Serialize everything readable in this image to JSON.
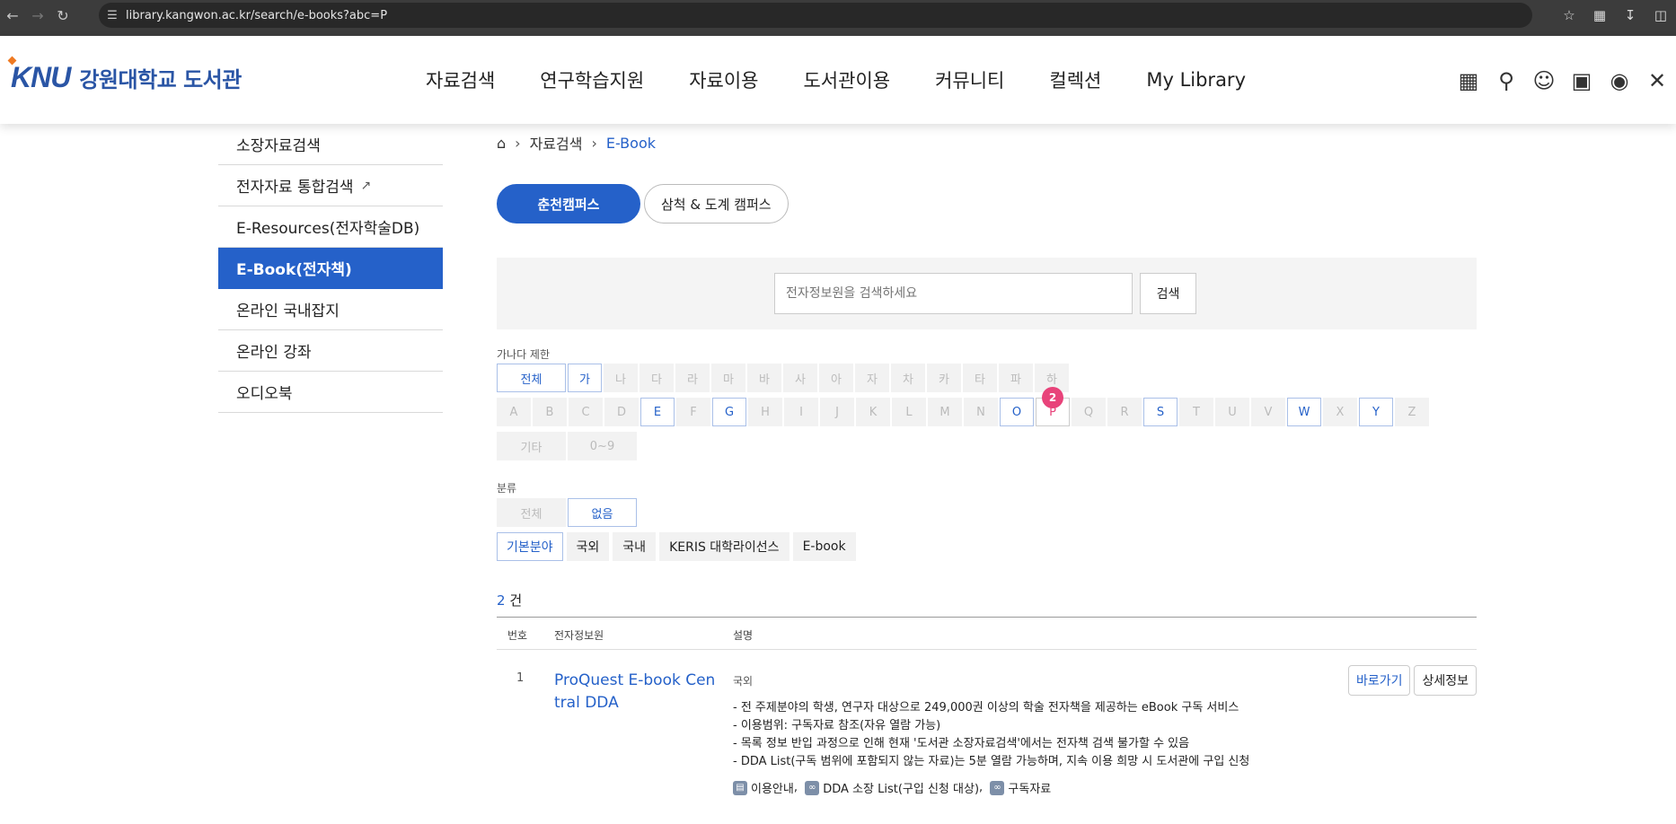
{
  "browser": {
    "url": "library.kangwon.ac.kr/search/e-books?abc=P"
  },
  "header": {
    "logo_mark": "KNU",
    "logo_name": "강원대학교 도서관",
    "nav": [
      "자료검색",
      "연구학습지원",
      "자료이용",
      "도서관이용",
      "커뮤니티",
      "컬렉션",
      "My Library"
    ]
  },
  "sidebar": {
    "items": [
      {
        "label": "소장자료검색"
      },
      {
        "label": "전자자료 통합검색"
      },
      {
        "label": "E-Resources(전자학술DB)"
      },
      {
        "label": "E-Book(전자책)"
      },
      {
        "label": "온라인 국내잡지"
      },
      {
        "label": "온라인 강좌"
      },
      {
        "label": "오디오북"
      }
    ]
  },
  "breadcrumb": {
    "level1": "자료검색",
    "current": "E-Book"
  },
  "campus_tabs": [
    "춘천캠퍼스",
    "삼척 & 도계 캠퍼스"
  ],
  "search": {
    "placeholder": "전자정보원을 검색하세요",
    "button": "검색"
  },
  "filter": {
    "label": "가나다 제한",
    "hangul": [
      "전체",
      "가",
      "나",
      "다",
      "라",
      "마",
      "바",
      "사",
      "아",
      "자",
      "차",
      "카",
      "타",
      "파",
      "하"
    ],
    "alpha": [
      "A",
      "B",
      "C",
      "D",
      "E",
      "F",
      "G",
      "H",
      "I",
      "J",
      "K",
      "L",
      "M",
      "N",
      "O",
      "P",
      "Q",
      "R",
      "S",
      "T",
      "U",
      "V",
      "W",
      "X",
      "Y",
      "Z"
    ],
    "other": [
      "기타",
      "0~9"
    ],
    "p_count": "2"
  },
  "category": {
    "label": "분류",
    "row1": [
      "전체",
      "없음"
    ],
    "row2": [
      "기본분야",
      "국외",
      "국내",
      "KERIS 대학라이선스",
      "E-book"
    ]
  },
  "results": {
    "count_num": "2",
    "count_unit": " 건",
    "headers": {
      "no": "번호",
      "name": "전자정보원",
      "desc": "설명"
    },
    "rows": [
      {
        "no": "1",
        "title": "ProQuest E-book Central DDA",
        "scope": "국외",
        "desc": [
          "- 전 주제분야의 학생, 연구자 대상으로 249,000권 이상의 학술 전자책을 제공하는 eBook 구독 서비스",
          "- 이용범위: 구독자료 참조(자유 열람 가능)",
          "- 목록 정보 반입 과정으로 인해 현재 '도서관 소장자료검색'에서는 전자책 검색 불가할 수 있음",
          "- DDA List(구독 범위에 포함되지 않는 자료)는 5분 열람 가능하며, 지속 이용 희망 시 도서관에 구입 신청"
        ],
        "links": [
          "이용안내",
          "DDA 소장 List(구입 신청 대상)",
          "구독자료"
        ],
        "btn_go": "바로가기",
        "btn_detail": "상세정보"
      }
    ]
  }
}
